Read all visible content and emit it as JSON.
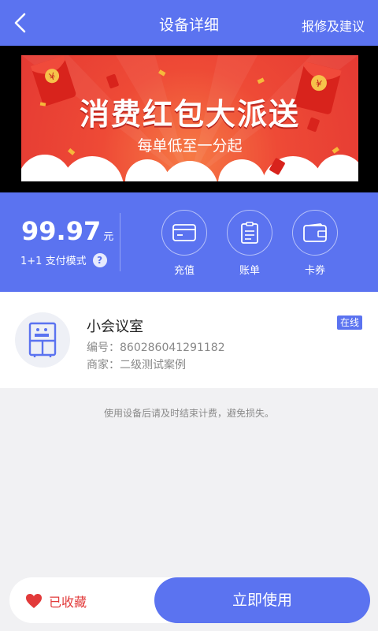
{
  "header": {
    "title": "设备详细",
    "action_label": "报修及建议",
    "back_icon": "chevron-left-icon"
  },
  "banner": {
    "title": "消费红包大派送",
    "subtitle": "每单低至一分起",
    "coin_symbol": "¥"
  },
  "wallet": {
    "balance": "99.97",
    "unit": "元",
    "pay_mode": "1+1 支付模式",
    "help": "?",
    "actions": [
      {
        "label": "充值",
        "icon": "card-icon"
      },
      {
        "label": "账单",
        "icon": "bill-icon"
      },
      {
        "label": "卡券",
        "icon": "wallet-icon"
      }
    ]
  },
  "device": {
    "name": "小会议室",
    "number": "编号：860286041291182",
    "merchant": "商家：二级测试案例",
    "status": "在线",
    "icon": "locker-icon"
  },
  "notice": "使用设备后请及时结束计费，避免损失。",
  "bottom": {
    "favorite_label": "已收藏",
    "use_label": "立即使用"
  },
  "colors": {
    "primary": "#5b73f0",
    "favorite": "#e23a3a",
    "background": "#f1f1f3"
  }
}
